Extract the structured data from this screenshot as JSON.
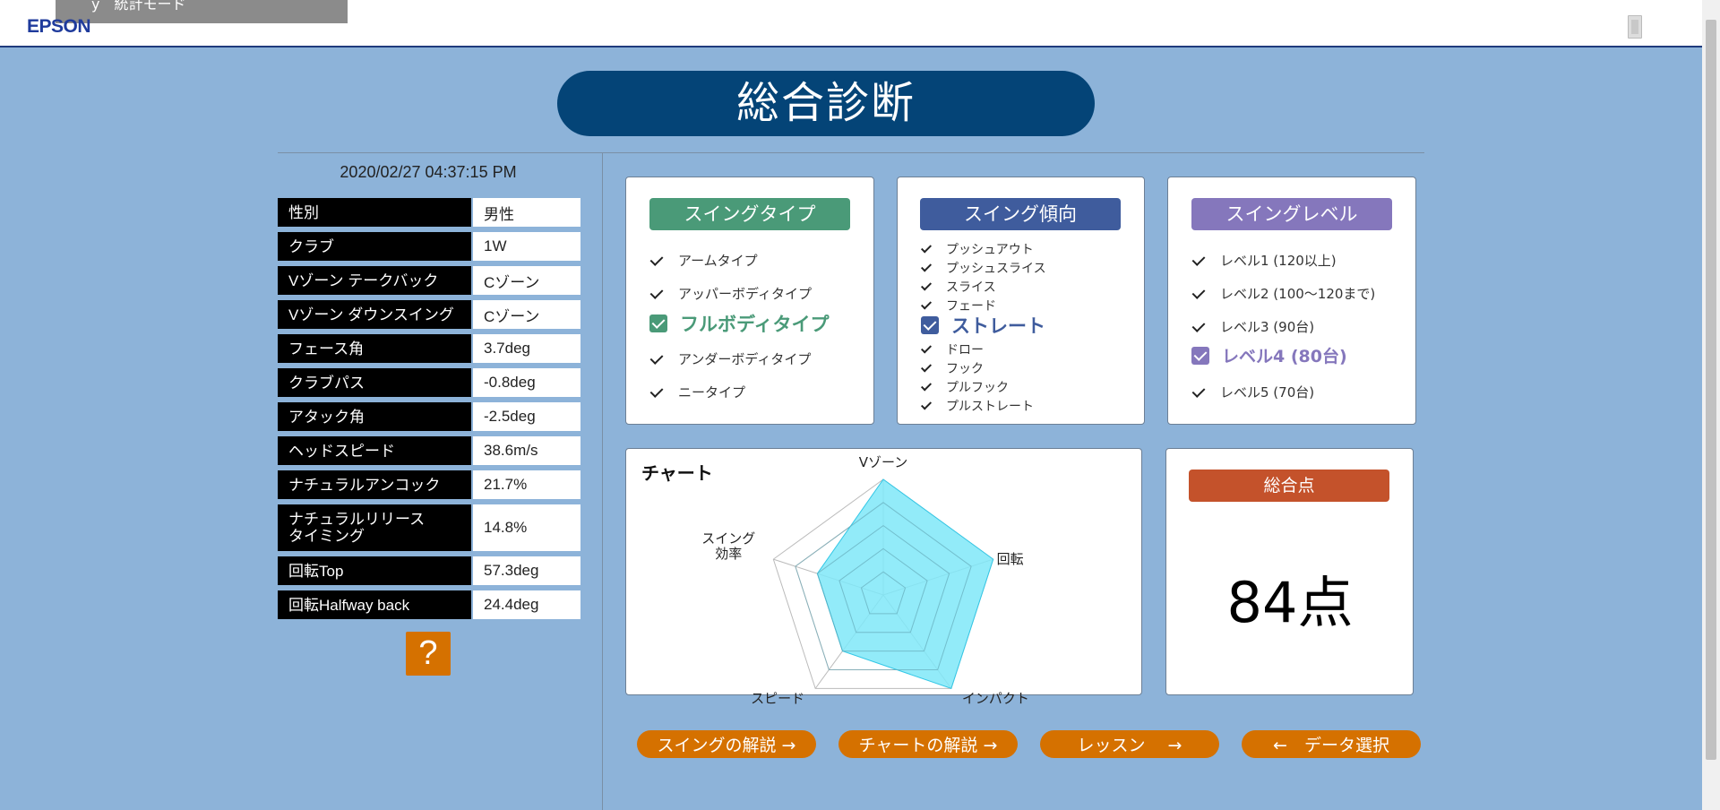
{
  "header": {
    "tooltip_text": "y　統計モード",
    "logo": "EPSON",
    "exit_icon": "exit-door-icon"
  },
  "page_title": "総合診断",
  "datetime": "2020/02/27 04:37:15 PM",
  "info": [
    {
      "key": "性別",
      "value": "男性"
    },
    {
      "key": "クラブ",
      "value": "1W"
    },
    {
      "key": "Vゾーン テークバック",
      "value": "Cゾーン"
    },
    {
      "key": "Vゾーン ダウンスイング",
      "value": "Cゾーン"
    },
    {
      "key": "フェース角",
      "value": "3.7deg"
    },
    {
      "key": "クラブパス",
      "value": "-0.8deg"
    },
    {
      "key": "アタック角",
      "value": "-2.5deg"
    },
    {
      "key": "ヘッドスピード",
      "value": "38.6m/s"
    },
    {
      "key": "ナチュラルアンコック",
      "value": "21.7%"
    },
    {
      "key": "ナチュラルリリース\nタイミング",
      "value": "14.8%"
    },
    {
      "key": "回転Top",
      "value": "57.3deg"
    },
    {
      "key": "回転Halfway back",
      "value": "24.4deg"
    }
  ],
  "help_label": "?",
  "swing_type": {
    "title": "スイングタイプ",
    "color": "#4a9a78",
    "options": [
      "アームタイプ",
      "アッパーボディタイプ",
      "フルボディタイプ",
      "アンダーボディタイプ",
      "ニータイプ"
    ],
    "selected_index": 2
  },
  "swing_tendency": {
    "title": "スイング傾向",
    "color": "#3f5c9d",
    "options": [
      "プッシュアウト",
      "プッシュスライス",
      "スライス",
      "フェード",
      "ストレート",
      "ドロー",
      "フック",
      "プルフック",
      "プルストレート"
    ],
    "selected_index": 4
  },
  "swing_level": {
    "title": "スイングレベル",
    "color": "#8577bc",
    "options": [
      "レベル1 (120以上)",
      "レベル2 (100〜120まで)",
      "レベル3 (90台)",
      "レベル4 (80台)",
      "レベル5 (70台)"
    ],
    "selected_index": 3
  },
  "chart": {
    "title": "チャート",
    "labels": [
      "Vゾーン",
      "回転",
      "インパクト",
      "スピード",
      "スイング\n効率"
    ]
  },
  "chart_data": {
    "type": "radar",
    "categories": [
      "Vゾーン",
      "回転",
      "インパクト",
      "スピード",
      "スイング効率"
    ],
    "values": [
      100,
      100,
      100,
      60,
      60
    ],
    "ylim": [
      0,
      100
    ],
    "levels": 5,
    "fill_color": "#7fe8f8",
    "stroke_color": "#33c7e6"
  },
  "score": {
    "title": "総合点",
    "value": "84点",
    "color": "#c4522b"
  },
  "buttons": {
    "swing_explain": "スイングの解説 →",
    "chart_explain": "チャートの解説 →",
    "lesson": "レッスン　 →",
    "data_select": "←　データ選択"
  }
}
